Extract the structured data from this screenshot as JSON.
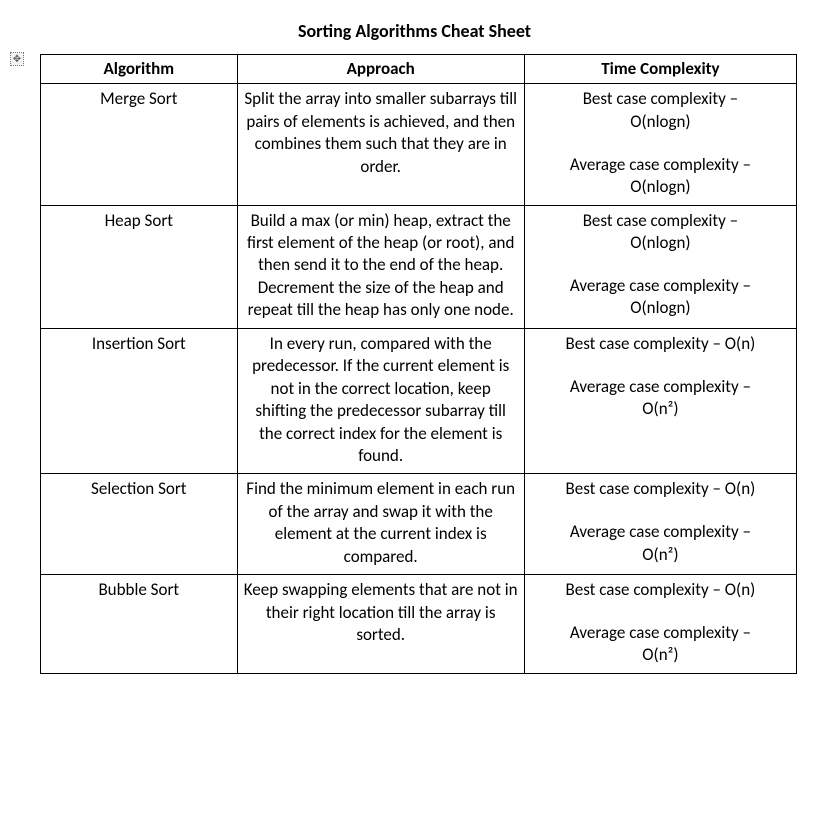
{
  "title": "Sorting Algorithms Cheat Sheet",
  "headers": {
    "algorithm": "Algorithm",
    "approach": "Approach",
    "complexity": "Time Complexity"
  },
  "rows": [
    {
      "algorithm": "Merge Sort",
      "approach": "Split the array into smaller subarrays till pairs of elements is achieved, and then combines them such that they are in order.",
      "best_label": "Best case complexity –",
      "best_value": "O(nlogn)",
      "avg_label": "Average case complexity –",
      "avg_value": "O(nlogn)"
    },
    {
      "algorithm": "Heap Sort",
      "approach": "Build a max (or min) heap, extract the first element of the heap (or root), and then send it to the end of the heap. Decrement the size of the heap and repeat till the heap has only one node.",
      "best_label": "Best case complexity –",
      "best_value": "O(nlogn)",
      "avg_label": "Average case complexity –",
      "avg_value": "O(nlogn)"
    },
    {
      "algorithm": "Insertion Sort",
      "approach": "In every run, compared with the predecessor. If the current element is not in the correct location, keep shifting the predecessor subarray till the correct index for the element is found.",
      "best_label": "Best case complexity – O(n)",
      "best_value": "",
      "avg_label": "Average case complexity –",
      "avg_value": "O(n²)"
    },
    {
      "algorithm": "Selection Sort",
      "approach": "Find the minimum element in each run of the array and swap it with the element at the current index is compared.",
      "best_label": "Best case complexity – O(n)",
      "best_value": "",
      "avg_label": "Average case complexity –",
      "avg_value": "O(n²)"
    },
    {
      "algorithm": "Bubble Sort",
      "approach": "Keep swapping elements that are not in their right location till the array is sorted.",
      "best_label": "Best case complexity – O(n)",
      "best_value": "",
      "avg_label": "Average case complexity –",
      "avg_value": "O(n²)"
    }
  ]
}
